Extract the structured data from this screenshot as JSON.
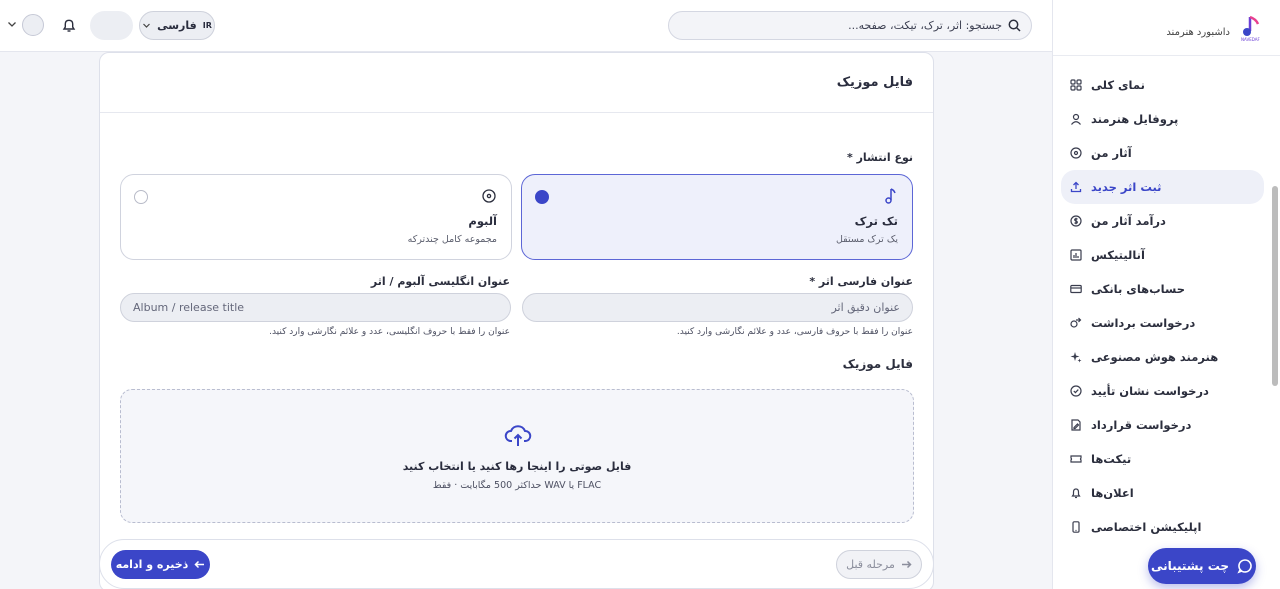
{
  "sidebar": {
    "brand_text": "داشبورد هنرمند",
    "items": [
      {
        "label": "نمای کلی",
        "icon": "grid-icon"
      },
      {
        "label": "پروفایل هنرمند",
        "icon": "user-icon"
      },
      {
        "label": "آثار من",
        "icon": "vinyl-icon"
      },
      {
        "label": "ثبت اثر جدید",
        "icon": "upload-icon",
        "active": true
      },
      {
        "label": "درآمد آثار من",
        "icon": "dollar-icon"
      },
      {
        "label": "آنالیتیکس",
        "icon": "chart-icon"
      },
      {
        "label": "حساب‌های بانکی",
        "icon": "card-icon"
      },
      {
        "label": "درخواست برداشت",
        "icon": "withdraw-icon"
      },
      {
        "label": "هنرمند هوش مصنوعی",
        "icon": "sparkle-icon"
      },
      {
        "label": "درخواست نشان تأیید",
        "icon": "check-circle-icon"
      },
      {
        "label": "درخواست قرارداد",
        "icon": "contract-icon"
      },
      {
        "label": "تیکت‌ها",
        "icon": "ticket-icon"
      },
      {
        "label": "اعلان‌ها",
        "icon": "bell-icon"
      },
      {
        "label": "اپلیکیشن اختصاصی",
        "icon": "phone-icon"
      }
    ],
    "chat_label": "چت پشتیبانی"
  },
  "topbar": {
    "search_placeholder": "جستجو: اثر، ترک، تیکت، صفحه...",
    "lang_code": "IR",
    "lang_label": "فارسی"
  },
  "card": {
    "title": "فایل موزیک",
    "release_type_label": "نوع انتشار *",
    "options": [
      {
        "title": "تک ترک",
        "subtitle": "یک ترک مستقل",
        "selected": true
      },
      {
        "title": "آلبوم",
        "subtitle": "مجموعه کامل چندترکه",
        "selected": false
      }
    ],
    "fa_title_label": "عنوان فارسی اثر *",
    "fa_title_placeholder": "عنوان دقیق اثر",
    "fa_title_hint": "عنوان را فقط با حروف فارسی، عدد و علائم نگارشی وارد کنید.",
    "en_title_label": "عنوان انگلیسی آلبوم / اثر",
    "en_title_placeholder": "Album / release title",
    "en_title_hint": "عنوان را فقط با حروف انگلیسی، عدد و علائم نگارشی وارد کنید.",
    "file_section_label": "فایل موزیک",
    "drop_title": "فایل صوتی را اینجا رها کنید یا انتخاب کنید",
    "drop_subtitle": "حداکثر 500 مگابایت · فقط WAV یا FLAC"
  },
  "footer": {
    "save_label": "ذخیره و ادامه",
    "prev_label": "مرحله قبل"
  },
  "colors": {
    "accent": "#3b46c8",
    "selected_bg": "#eef0fb"
  }
}
